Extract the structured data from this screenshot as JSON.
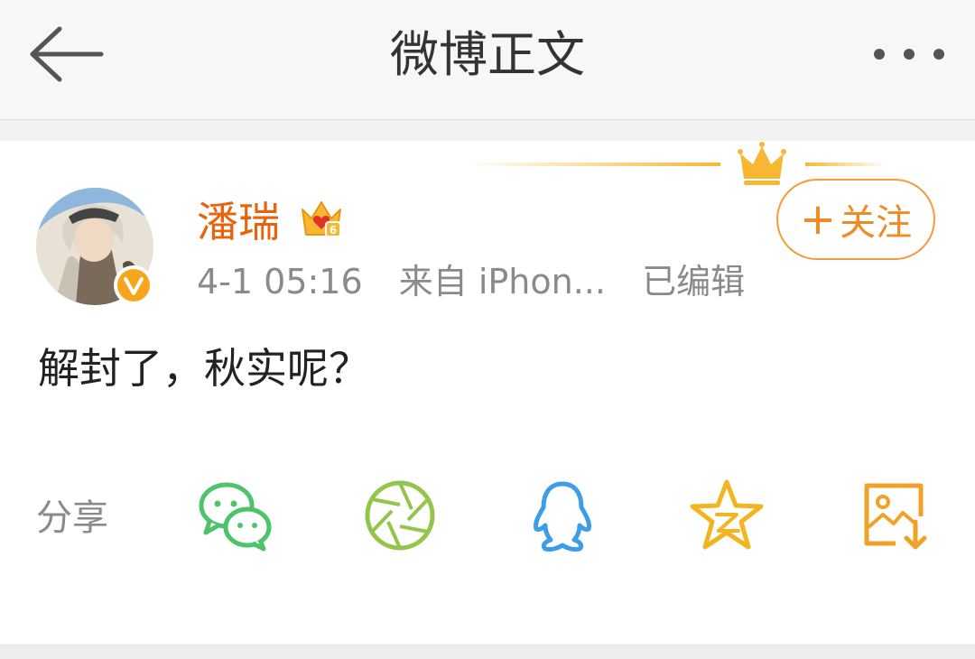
{
  "header": {
    "back_icon": "back-arrow-icon",
    "title": "微博正文",
    "more_icon": "more-dots-icon"
  },
  "post": {
    "author": {
      "name": "潘瑞",
      "avatar": "avatar-image",
      "verified_icon": "verified-v-icon",
      "member_icon": "crown-member-icon"
    },
    "follow_button": {
      "plus": "+",
      "label": "关注"
    },
    "meta": {
      "time": "4-1 05:16",
      "source": "来自 iPhon...",
      "edited": "已编辑"
    },
    "text": "解封了，秋实呢？"
  },
  "share": {
    "label": "分享",
    "targets": [
      {
        "name": "wechat",
        "icon": "wechat-icon",
        "color": "#4fc36a"
      },
      {
        "name": "moments",
        "icon": "moments-aperture-icon",
        "color": "#93c54b"
      },
      {
        "name": "qq",
        "icon": "qq-penguin-icon",
        "color": "#3d9ee8"
      },
      {
        "name": "qzone",
        "icon": "qzone-star-icon",
        "color": "#f3b51f"
      },
      {
        "name": "save-image",
        "icon": "save-image-icon",
        "color": "#f0a127"
      }
    ]
  },
  "colors": {
    "username": "#e8640c",
    "follow": "#f28a23",
    "verified": "#f7a51c"
  }
}
